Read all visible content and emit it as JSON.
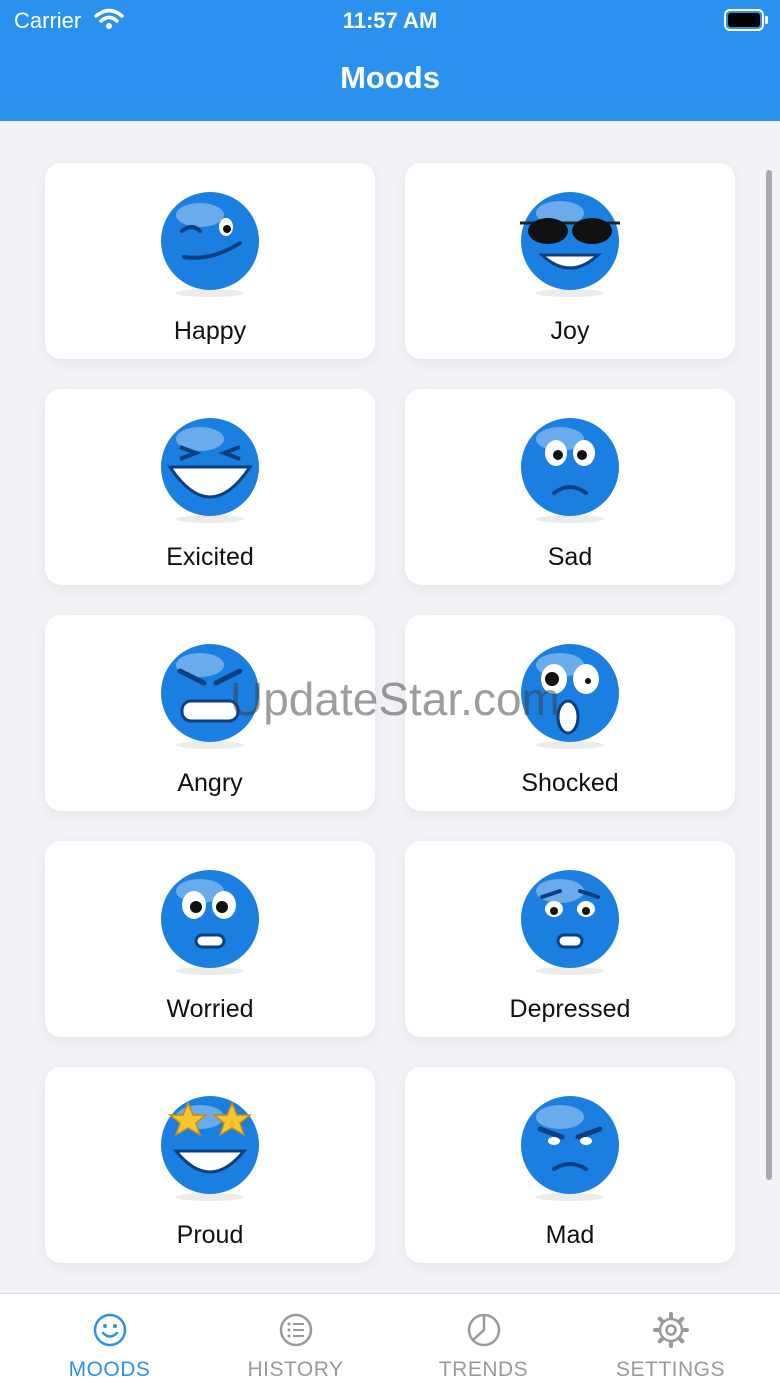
{
  "status_bar": {
    "carrier": "Carrier",
    "time": "11:57 AM"
  },
  "header": {
    "title": "Moods"
  },
  "moods": [
    {
      "label": "Happy",
      "icon": "wink-face-icon"
    },
    {
      "label": "Joy",
      "icon": "sunglasses-face-icon"
    },
    {
      "label": "Exicited",
      "icon": "laughing-face-icon"
    },
    {
      "label": "Sad",
      "icon": "sad-face-icon"
    },
    {
      "label": "Angry",
      "icon": "angry-face-icon"
    },
    {
      "label": "Shocked",
      "icon": "shocked-face-icon"
    },
    {
      "label": "Worried",
      "icon": "worried-face-icon"
    },
    {
      "label": "Depressed",
      "icon": "depressed-face-icon"
    },
    {
      "label": "Proud",
      "icon": "star-eyes-face-icon"
    },
    {
      "label": "Mad",
      "icon": "mad-face-icon"
    }
  ],
  "watermark": "UpdateStar.com",
  "tabs": [
    {
      "label": "MOODS",
      "icon": "smile-icon",
      "active": true
    },
    {
      "label": "HISTORY",
      "icon": "list-icon",
      "active": false
    },
    {
      "label": "TRENDS",
      "icon": "pie-chart-icon",
      "active": false
    },
    {
      "label": "SETTINGS",
      "icon": "gear-icon",
      "active": false
    }
  ],
  "colors": {
    "accent": "#2b91ef",
    "face_blue": "#1a7fe0",
    "tab_inactive": "#9a9a9e",
    "background": "#f2f2f7"
  }
}
